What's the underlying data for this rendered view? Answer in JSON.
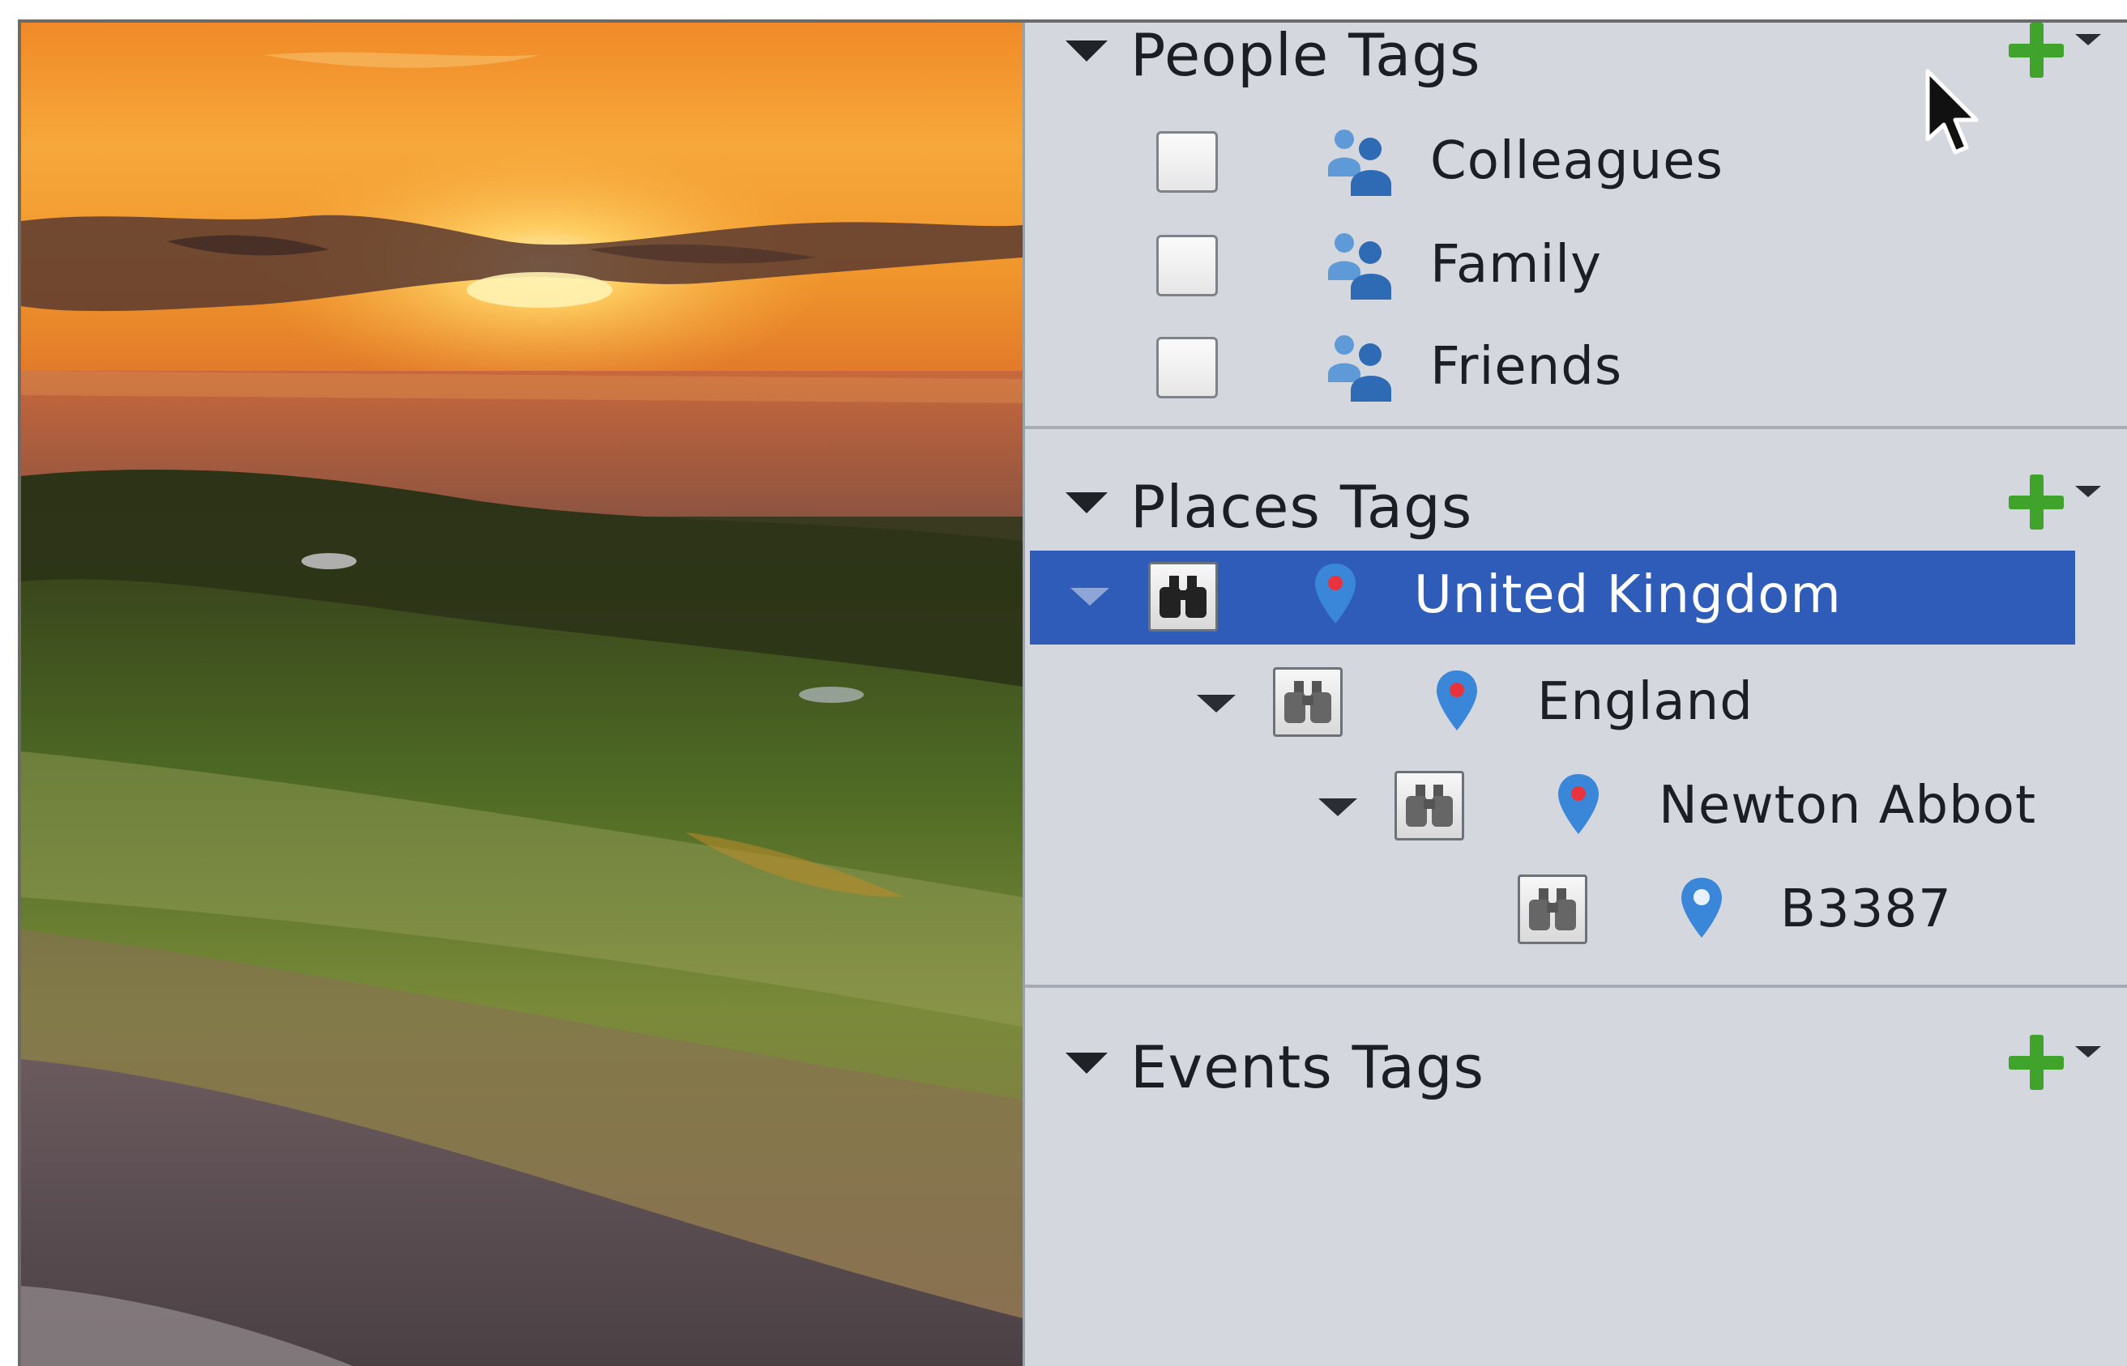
{
  "people_tags": {
    "title": "People Tags",
    "add_icon": "green-plus-icon",
    "items": [
      {
        "label": "Colleagues",
        "checked": false,
        "icon": "people-group-icon"
      },
      {
        "label": "Family",
        "checked": false,
        "icon": "people-group-icon"
      },
      {
        "label": "Friends",
        "checked": false,
        "icon": "people-group-icon"
      }
    ]
  },
  "places_tags": {
    "title": "Places Tags",
    "add_icon": "green-plus-icon",
    "items": [
      {
        "label": "United Kingdom",
        "level": 0,
        "selected": true,
        "expanded": true,
        "icon": "map-pin-icon"
      },
      {
        "label": "England",
        "level": 1,
        "selected": false,
        "expanded": true,
        "icon": "map-pin-icon"
      },
      {
        "label": "Newton Abbot",
        "level": 2,
        "selected": false,
        "expanded": true,
        "icon": "map-pin-icon"
      },
      {
        "label": "B3387",
        "level": 3,
        "selected": false,
        "expanded": false,
        "icon": "map-pin-icon"
      }
    ]
  },
  "events_tags": {
    "title": "Events Tags",
    "add_icon": "green-plus-icon"
  },
  "colors": {
    "panel_bg": "#d4d8de",
    "selection": "#2f5cb8",
    "add_green": "#3fa32c",
    "pin_blue": "#3a86d8",
    "pin_red_dot": "#e8323c"
  }
}
